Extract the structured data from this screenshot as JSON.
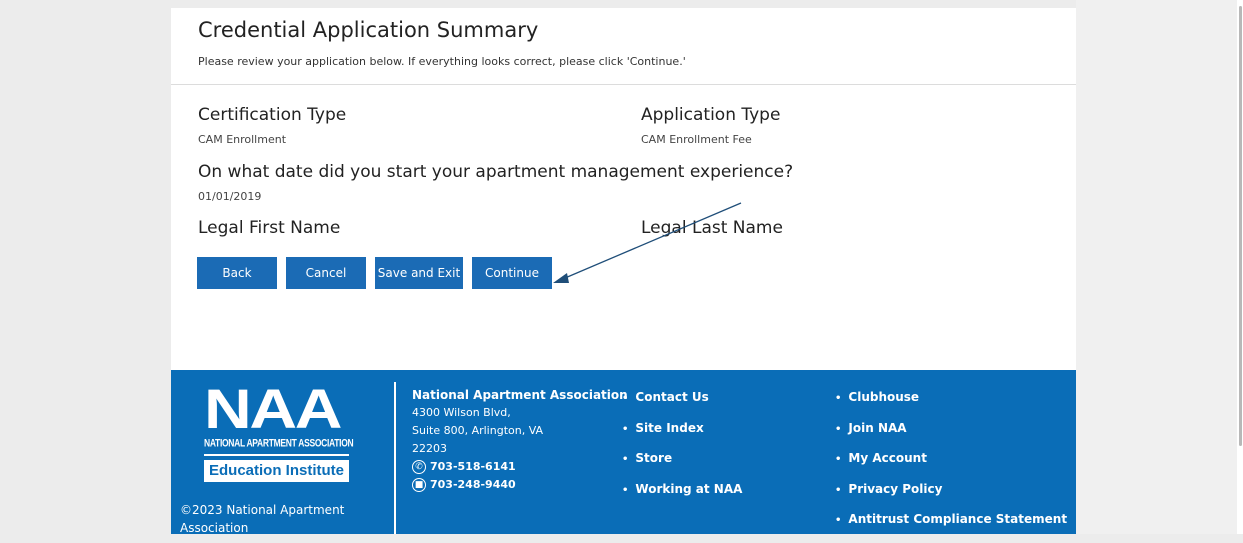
{
  "summary": {
    "title": "Credential Application Summary",
    "intro": "Please review your application below. If everything looks correct, please click 'Continue.'"
  },
  "fields": {
    "certification_type": {
      "label": "Certification Type",
      "value": "CAM Enrollment"
    },
    "application_type": {
      "label": "Application Type",
      "value": "CAM Enrollment Fee"
    },
    "start_date": {
      "label": "On what date did you start your apartment management experience?",
      "value": "01/01/2019"
    },
    "legal_first_name": {
      "label": "Legal First Name"
    },
    "legal_last_name": {
      "label": "Legal Last Name"
    }
  },
  "buttons": {
    "back": "Back",
    "cancel": "Cancel",
    "save_exit": "Save and Exit",
    "continue": "Continue"
  },
  "colors": {
    "button": "#1b6bb5",
    "footer": "#0a6db7",
    "annotation_arrow": "#1f4e79"
  },
  "footer": {
    "logo": {
      "letters": "NAA",
      "org": "NATIONAL APARTMENT ASSOCIATION",
      "institute": "Education Institute"
    },
    "copyright": "©2023 National Apartment Association",
    "address": {
      "org": "National Apartment Association",
      "line1": "4300 Wilson Blvd,",
      "line2": "Suite 800, Arlington, VA",
      "line3": "22203"
    },
    "phone": "703-518-6141",
    "fax": "703-248-9440",
    "links_col1": [
      "Contact Us",
      "Site Index",
      "Store",
      "Working at NAA"
    ],
    "links_col2": [
      "Clubhouse",
      "Join NAA",
      "My Account",
      "Privacy Policy",
      "Antitrust Compliance Statement"
    ]
  },
  "icons": {
    "phone": "phone-icon",
    "fax": "fax-icon",
    "annotation": "arrow-annotation-icon"
  }
}
